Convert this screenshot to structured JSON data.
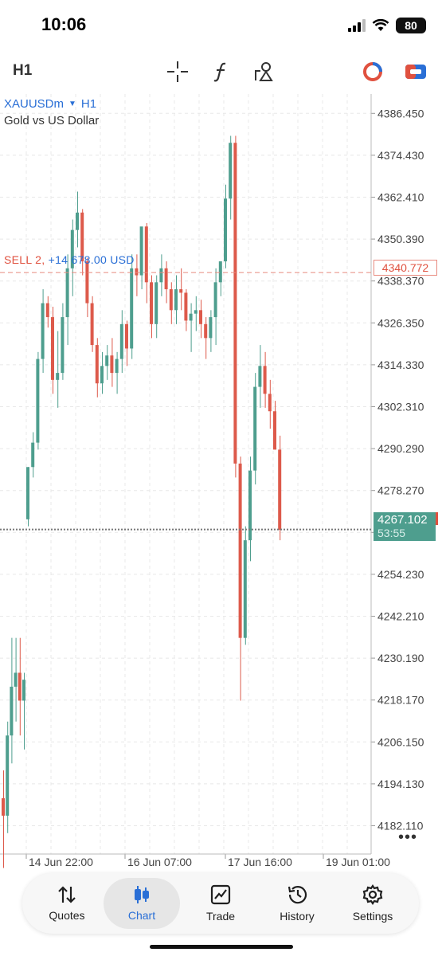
{
  "status_bar": {
    "time": "10:06",
    "battery": "80"
  },
  "toolbar": {
    "timeframe": "H1",
    "tools": [
      {
        "name": "crosshair-icon"
      },
      {
        "name": "indicators-icon"
      },
      {
        "name": "objects-icon"
      }
    ],
    "right_icons": [
      "one-click-trading-icon",
      "trade-panel-icon"
    ]
  },
  "chart": {
    "symbol": "XAUUSDm",
    "timeframe": "H1",
    "description": "Gold vs US Dollar",
    "position": {
      "side": "SELL 2,",
      "profit": "+14 678.00 USD",
      "price": "4340.772"
    },
    "current_price": "4267.102",
    "countdown": "53:55",
    "more_label": "•••"
  },
  "chart_data": {
    "type": "candlestick",
    "symbol": "XAUUSDm",
    "timeframe": "H1",
    "y_ticks": [
      "4386.450",
      "4374.430",
      "4362.410",
      "4350.390",
      "4338.370",
      "4326.350",
      "4314.330",
      "4302.310",
      "4290.290",
      "4278.270",
      "4266.250",
      "4254.230",
      "4242.210",
      "4230.190",
      "4218.170",
      "4206.150",
      "4194.130",
      "4182.110"
    ],
    "x_ticks": [
      "14 Jun 22:00",
      "16 Jun 07:00",
      "17 Jun 16:00",
      "19 Jun 01:00"
    ],
    "ylim": [
      4174.0,
      4392.0
    ],
    "position_line": 4340.772,
    "current_price_line": 4267.102,
    "colors": {
      "up": "#4e9e8e",
      "down": "#dd5a4b",
      "grid": "#e8e8e8",
      "position_line": "#e88a7f",
      "price_line": "#777777"
    },
    "candles": [
      [
        4190,
        4198,
        4170,
        4185
      ],
      [
        4185,
        4212,
        4180,
        4208
      ],
      [
        4208,
        4236,
        4200,
        4222
      ],
      [
        4222,
        4236,
        4212,
        4226
      ],
      [
        4226,
        4236,
        4208,
        4218
      ],
      [
        4218,
        4226,
        4204,
        4224
      ],
      [
        4270,
        4285,
        4268,
        4285
      ],
      [
        4285,
        4295,
        4282,
        4292
      ],
      [
        4292,
        4318,
        4290,
        4316
      ],
      [
        4316,
        4336,
        4312,
        4332
      ],
      [
        4332,
        4334,
        4325,
        4328
      ],
      [
        4328,
        4331,
        4306,
        4310
      ],
      [
        4310,
        4324,
        4302,
        4312
      ],
      [
        4312,
        4332,
        4310,
        4328
      ],
      [
        4328,
        4346,
        4320,
        4342
      ],
      [
        4342,
        4356,
        4334,
        4353
      ],
      [
        4353,
        4364,
        4348,
        4358
      ],
      [
        4358,
        4359,
        4340,
        4344
      ],
      [
        4344,
        4345,
        4328,
        4332
      ],
      [
        4332,
        4334,
        4318,
        4320
      ],
      [
        4320,
        4322,
        4305,
        4309
      ],
      [
        4309,
        4318,
        4306,
        4314
      ],
      [
        4314,
        4320,
        4310,
        4317
      ],
      [
        4317,
        4322,
        4308,
        4312
      ],
      [
        4312,
        4318,
        4306,
        4316
      ],
      [
        4316,
        4330,
        4312,
        4326
      ],
      [
        4326,
        4327,
        4314,
        4319
      ],
      [
        4319,
        4346,
        4316,
        4342
      ],
      [
        4342,
        4346,
        4334,
        4340
      ],
      [
        4340,
        4352,
        4336,
        4354
      ],
      [
        4354,
        4355,
        4332,
        4338
      ],
      [
        4338,
        4340,
        4322,
        4326
      ],
      [
        4326,
        4340,
        4322,
        4338
      ],
      [
        4338,
        4346,
        4334,
        4342
      ],
      [
        4342,
        4344,
        4332,
        4336
      ],
      [
        4336,
        4338,
        4326,
        4330
      ],
      [
        4330,
        4340,
        4326,
        4336
      ],
      [
        4336,
        4342,
        4330,
        4335
      ],
      [
        4335,
        4336,
        4324,
        4327
      ],
      [
        4327,
        4332,
        4318,
        4329
      ],
      [
        4329,
        4334,
        4324,
        4330
      ],
      [
        4330,
        4333,
        4322,
        4326
      ],
      [
        4326,
        4328,
        4316,
        4322
      ],
      [
        4322,
        4330,
        4318,
        4328
      ],
      [
        4328,
        4342,
        4320,
        4338
      ],
      [
        4338,
        4344,
        4334,
        4344
      ],
      [
        4344,
        4366,
        4342,
        4362
      ],
      [
        4362,
        4380,
        4356,
        4378
      ],
      [
        4378,
        4380,
        4282,
        4286
      ],
      [
        4286,
        4288,
        4218,
        4236
      ],
      [
        4236,
        4268,
        4234,
        4264
      ],
      [
        4264,
        4288,
        4258,
        4284
      ],
      [
        4284,
        4312,
        4280,
        4308
      ],
      [
        4308,
        4320,
        4302,
        4314
      ],
      [
        4314,
        4318,
        4302,
        4306
      ],
      [
        4306,
        4310,
        4296,
        4301
      ],
      [
        4301,
        4304,
        4290,
        4290
      ],
      [
        4290,
        4294,
        4264,
        4267
      ]
    ]
  },
  "tabs": [
    {
      "label": "Quotes",
      "icon": "quotes-icon",
      "active": false
    },
    {
      "label": "Chart",
      "icon": "chart-candles-icon",
      "active": true
    },
    {
      "label": "Trade",
      "icon": "trade-icon",
      "active": false
    },
    {
      "label": "History",
      "icon": "history-icon",
      "active": false
    },
    {
      "label": "Settings",
      "icon": "settings-gear-icon",
      "active": false
    }
  ]
}
